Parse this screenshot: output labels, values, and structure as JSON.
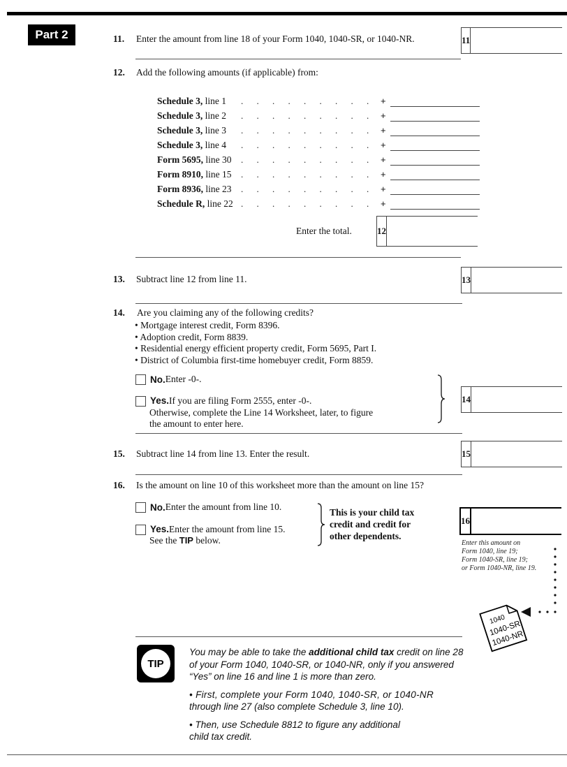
{
  "part_label": "Part 2",
  "lines": {
    "l11": {
      "num": "11.",
      "text": "Enter the amount from line 18 of your Form 1040, 1040-SR, or 1040-NR.",
      "box": "11",
      "value": ""
    },
    "l12": {
      "num": "12.",
      "text": "Add the following amounts (if applicable) from:",
      "items": [
        {
          "bold": "Schedule 3,",
          "rest": " line 1",
          "value": ""
        },
        {
          "bold": "Schedule 3,",
          "rest": " line 2",
          "value": ""
        },
        {
          "bold": "Schedule 3,",
          "rest": " line 3",
          "value": ""
        },
        {
          "bold": "Schedule 3,",
          "rest": " line 4",
          "value": ""
        },
        {
          "bold": "Form 5695,",
          "rest": " line 30",
          "value": ""
        },
        {
          "bold": "Form 8910,",
          "rest": " line 15",
          "value": ""
        },
        {
          "bold": "Form 8936,",
          "rest": " line 23",
          "value": ""
        },
        {
          "bold": "Schedule R,",
          "rest": " line 22",
          "value": ""
        }
      ],
      "dots": ". . . . . . . . . . . . .",
      "plus": "+",
      "total_label": "Enter the total.",
      "box": "12",
      "value": ""
    },
    "l13": {
      "num": "13.",
      "text": "Subtract line 12 from line 11.",
      "box": "13",
      "value": ""
    },
    "l14": {
      "num": "14.",
      "text": "Are you claiming any of the following credits?",
      "bullets": [
        "• Mortgage interest credit, Form 8396.",
        "• Adoption credit, Form 8839.",
        "• Residential energy efficient property credit, Form 5695, Part I.",
        "• District of Columbia first-time homebuyer credit, Form 8859."
      ],
      "no_label": "No.",
      "no_text": " Enter -0-.",
      "yes_label": "Yes.",
      "yes_text": " If you are filing Form 2555, enter -0-.",
      "yes_text2": "Otherwise, complete the Line 14 Worksheet, later, to figure",
      "yes_text3": "the amount to enter here.",
      "box": "14",
      "value": ""
    },
    "l15": {
      "num": "15.",
      "text": "Subtract line 14 from line 13. Enter the result.",
      "box": "15",
      "value": ""
    },
    "l16": {
      "num": "16.",
      "text": "Is the amount on line 10 of this worksheet more than the amount on line 15?",
      "no_label": "No.",
      "no_text": " Enter the amount from line 10.",
      "yes_label": "Yes.",
      "yes_text": " Enter the amount from line 15.",
      "see_pre": "See the ",
      "see_tip": "TIP",
      "see_post": " below.",
      "result_text": [
        "This is your child tax",
        "credit and credit for",
        "other dependents."
      ],
      "box": "16",
      "value": "",
      "note": [
        "Enter this amount on",
        "Form 1040, line 19;",
        "Form 1040-SR, line 19;",
        "or Form 1040-NR, line 19."
      ],
      "form_icon_labels": [
        "1040",
        "1040-SR",
        "1040-NR"
      ]
    }
  },
  "tip": {
    "icon_label": "TIP",
    "p1_pre": "You may be able to take the ",
    "p1_bold": "additional child tax",
    "p1_post": " credit on line 28",
    "p1_line2": "of your Form 1040, 1040-SR, or 1040-NR, only if you answered",
    "p1_line3": "“Yes” on line 16 and line 1 is more than zero.",
    "b1_line1": "•  First, complete your Form 1040, 1040-SR, or 1040-NR",
    "b1_line2": "through line 27 (also complete Schedule 3, line 10).",
    "b2_line1": "•  Then, use Schedule 8812 to figure any additional",
    "b2_line2": "child tax credit."
  }
}
